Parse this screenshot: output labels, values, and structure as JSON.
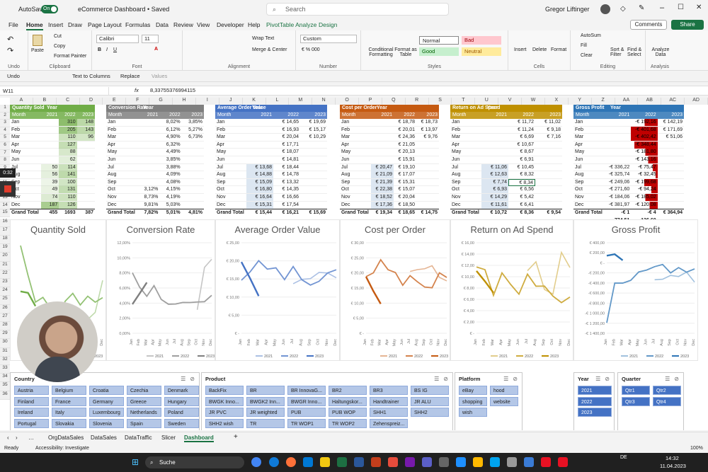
{
  "title_bar": {
    "autosave_label": "AutoSave",
    "autosave_state": "On",
    "file_name": "eCommerce Dashboard • Saved",
    "search_placeholder": "Search",
    "user_name": "Gregor Liftinger"
  },
  "menu": [
    "File",
    "Home",
    "Insert",
    "Draw",
    "Page Layout",
    "Formulas",
    "Data",
    "Review",
    "View",
    "Developer",
    "Help",
    "PivotTable Analyze",
    "Design"
  ],
  "menu_active": "Home",
  "buttons": {
    "comments": "Comments",
    "share": "Share"
  },
  "ribbon": {
    "undo": "Undo",
    "paste": "Paste",
    "cut": "Cut",
    "copy": "Copy",
    "format_painter": "Format Painter",
    "font_name": "Calibri",
    "font_size": "11",
    "wrap_text": "Wrap Text",
    "merge_center": "Merge & Center",
    "number_format": "Custom",
    "conditional_formatting": "Conditional Formatting",
    "format_as_table": "Format as Table",
    "style_normal": "Normal",
    "style_bad": "Bad",
    "style_good": "Good",
    "style_neutral": "Neutral",
    "insert": "Insert",
    "delete": "Delete",
    "format": "Format",
    "autosum": "AutoSum",
    "fill": "Fill",
    "clear": "Clear",
    "sort_filter": "Sort & Filter",
    "find_select": "Find & Select",
    "analyze_data": "Analyze Data",
    "groups": [
      "Undo",
      "Clipboard",
      "Font",
      "Alignment",
      "Number",
      "Styles",
      "Cells",
      "Editing",
      "Analysis"
    ]
  },
  "quick_access": {
    "undo": "Undo",
    "text_to_columns": "Text to Columns",
    "replace": "Replace",
    "values": "Values"
  },
  "formula_bar": {
    "name_box": "W11",
    "fx": "fx",
    "formula": "8,33755376994115"
  },
  "col_letters": [
    "A",
    "B",
    "C",
    "D",
    "E",
    "F",
    "G",
    "H",
    "I",
    "J",
    "K",
    "L",
    "M",
    "N",
    "O",
    "P",
    "Q",
    "R",
    "S",
    "T",
    "U",
    "V",
    "W",
    "X",
    "Y",
    "Z",
    "AA",
    "AB",
    "AC",
    "AD"
  ],
  "months": [
    "Jan",
    "Feb",
    "Mar",
    "Apr",
    "May",
    "Jun",
    "Jul",
    "Aug",
    "Sep",
    "Oct",
    "Nov",
    "Dec"
  ],
  "pivots": [
    {
      "title": "Quantity Sold",
      "color": "#70ad47",
      "year_label": "Year",
      "sub": [
        "Month",
        "2021",
        "2022",
        "2023"
      ],
      "rows": [
        [
          "",
          "310",
          "148"
        ],
        [
          "",
          "205",
          "143"
        ],
        [
          "",
          "110",
          "96"
        ],
        [
          "",
          "127",
          ""
        ],
        [
          "",
          "88",
          ""
        ],
        [
          "",
          "62",
          ""
        ],
        [
          "50",
          "114",
          ""
        ],
        [
          "56",
          "141",
          ""
        ],
        [
          "39",
          "100",
          ""
        ],
        [
          "49",
          "131",
          ""
        ],
        [
          "74",
          "110",
          ""
        ],
        [
          "187",
          "126",
          ""
        ]
      ],
      "total": [
        "455",
        "1693",
        "387"
      ]
    },
    {
      "title": "Conversion Rate",
      "color": "#7f7f7f",
      "year_label": "Year",
      "sub": [
        "Month",
        "2021",
        "2022",
        "2023"
      ],
      "rows": [
        [
          "",
          "8,02%",
          "3,85%"
        ],
        [
          "",
          "6,12%",
          "5,27%"
        ],
        [
          "",
          "4,90%",
          "6,73%"
        ],
        [
          "",
          "6,32%",
          ""
        ],
        [
          "",
          "4,49%",
          ""
        ],
        [
          "",
          "3,85%",
          ""
        ],
        [
          "",
          "3,88%",
          ""
        ],
        [
          "",
          "4,09%",
          ""
        ],
        [
          "",
          "4,08%",
          ""
        ],
        [
          "3,12%",
          "4,15%",
          ""
        ],
        [
          "8,73%",
          "4,19%",
          ""
        ],
        [
          "9,81%",
          "5,03%",
          ""
        ]
      ],
      "total": [
        "7,82%",
        "5,01%",
        "4,81%"
      ]
    },
    {
      "title": "Average Order Value",
      "color": "#4472c4",
      "year_label": "Year",
      "sub": [
        "Month",
        "2021",
        "2022",
        "2023"
      ],
      "rows": [
        [
          "",
          "€ 14,65",
          "€ 19,69"
        ],
        [
          "",
          "€ 16,93",
          "€ 15,17"
        ],
        [
          "",
          "€ 20,04",
          "€ 10,29"
        ],
        [
          "",
          "€ 17,71",
          ""
        ],
        [
          "",
          "€ 18,07",
          ""
        ],
        [
          "",
          "€ 14,81",
          ""
        ],
        [
          "€ 13,68",
          "€ 18,44",
          ""
        ],
        [
          "€ 14,88",
          "€ 14,78",
          ""
        ],
        [
          "€ 15,09",
          "€ 13,32",
          ""
        ],
        [
          "€ 16,80",
          "€ 14,35",
          ""
        ],
        [
          "€ 16,64",
          "€ 16,66",
          ""
        ],
        [
          "€ 15,31",
          "€ 17,54",
          ""
        ]
      ],
      "total": [
        "€ 15,44",
        "€ 16,21",
        "€ 15,69"
      ]
    },
    {
      "title": "Cost per Order",
      "color": "#c55a11",
      "year_label": "Year",
      "sub": [
        "Month",
        "2021",
        "2022",
        "2023"
      ],
      "rows": [
        [
          "",
          "€ 18,78",
          "€ 18,73"
        ],
        [
          "",
          "€ 20,01",
          "€ 13,97"
        ],
        [
          "",
          "€ 24,36",
          "€ 9,76"
        ],
        [
          "",
          "€ 21,05",
          ""
        ],
        [
          "",
          "€ 20,13",
          ""
        ],
        [
          "",
          "€ 15,91",
          ""
        ],
        [
          "€ 20,47",
          "€ 19,10",
          ""
        ],
        [
          "€ 21,09",
          "€ 17,07",
          ""
        ],
        [
          "€ 21,39",
          "€ 15,31",
          ""
        ],
        [
          "€ 22,38",
          "€ 15,07",
          ""
        ],
        [
          "€ 18,52",
          "€ 20,04",
          ""
        ],
        [
          "€ 17,36",
          "€ 18,50",
          ""
        ]
      ],
      "total": [
        "€ 19,34",
        "€ 18,65",
        "€ 14,75"
      ]
    },
    {
      "title": "Return on Ad Spend",
      "color": "#bf9000",
      "year_label": "Year",
      "sub": [
        "Month",
        "2021",
        "2022",
        "2023"
      ],
      "rows": [
        [
          "",
          "€ 11,72",
          "€ 11,02"
        ],
        [
          "",
          "€ 11,24",
          "€ 9,18"
        ],
        [
          "",
          "€ 6,69",
          "€ 7,16"
        ],
        [
          "",
          "€ 10,67",
          ""
        ],
        [
          "",
          "€ 8,67",
          ""
        ],
        [
          "",
          "€ 6,91",
          ""
        ],
        [
          "€ 11,06",
          "€ 10,45",
          ""
        ],
        [
          "€ 12,63",
          "€ 8,32",
          ""
        ],
        [
          "€ 7,74",
          "€ 8,34",
          ""
        ],
        [
          "€ 6,93",
          "€ 6,56",
          ""
        ],
        [
          "€ 14,29",
          "€ 5,42",
          ""
        ],
        [
          "€ 11,61",
          "€ 6,41",
          ""
        ]
      ],
      "total": [
        "€ 10,72",
        "€ 8,36",
        "€ 9,54"
      ]
    },
    {
      "title": "Gross Profit",
      "color": "#2e75b6",
      "year_label": "Year",
      "sub": [
        "Month",
        "2021",
        "2022",
        "2023"
      ],
      "rows": [
        [
          "",
          "-€ 192,16",
          "€ 142,19"
        ],
        [
          "",
          "-€ 401,68",
          "€ 171,69"
        ],
        [
          "",
          "-€ 402,42",
          "€ 51,06"
        ],
        [
          "",
          "-€ 348,44",
          ""
        ],
        [
          "",
          "-€ 181,80",
          ""
        ],
        [
          "",
          "-€ 143,16",
          ""
        ],
        [
          "-€ 336,22",
          "-€ 75,47",
          ""
        ],
        [
          "-€ 325,74",
          "-€ 32,45",
          ""
        ],
        [
          "-€ 249,06",
          "-€ 199,68",
          ""
        ],
        [
          "-€ 271,60",
          "-€ 94,24",
          ""
        ],
        [
          "-€ 184,06",
          "-€ 185,02",
          ""
        ],
        [
          "-€ 381,97",
          "-€ 120,08",
          ""
        ]
      ],
      "total": [
        "-€ 1 774,51",
        "-€ 4 136,60",
        "€ 364,94"
      ]
    }
  ],
  "grand_total_label": "Grand Total",
  "charts": [
    {
      "title": "Quantity Sold",
      "yticks": [],
      "color_2021": "#a9d18e",
      "color_2022": "#70ad47",
      "color_2023": "#375623"
    },
    {
      "title": "Conversion Rate",
      "yticks": [
        "12,00%",
        "10,00%",
        "8,00%",
        "6,00%",
        "4,00%",
        "2,00%",
        "0,00%"
      ]
    },
    {
      "title": "Average Order Value",
      "yticks": [
        "€ 25,00",
        "€ 20,00",
        "€ 15,00",
        "€ 10,00",
        "€ 5,00",
        "€ -"
      ]
    },
    {
      "title": "Cost per Order",
      "yticks": [
        "€ 30,00",
        "€ 25,00",
        "€ 20,00",
        "€ 15,00",
        "€ 10,00",
        "€ 5,00",
        "€ -"
      ]
    },
    {
      "title": "Return on Ad Spend",
      "yticks": [
        "€ 16,00",
        "€ 14,00",
        "€ 12,00",
        "€ 10,00",
        "€ 8,00",
        "€ 6,00",
        "€ 4,00",
        "€ 2,00",
        "€ -"
      ]
    },
    {
      "title": "Gross Profit",
      "yticks": [
        "€ 400,00",
        "€ 200,00",
        "€ -",
        "-€ 200,00",
        "-€ 400,00",
        "-€ 600,00",
        "-€ 800,00",
        "-€ 1 000,00",
        "-€ 1 200,00",
        "-€ 1 400,00"
      ]
    }
  ],
  "legend": [
    "2021",
    "2022",
    "2023"
  ],
  "chart_data": [
    {
      "type": "line",
      "title": "Quantity Sold",
      "x": [
        "Jan",
        "Feb",
        "Mar",
        "Apr",
        "May",
        "Jun",
        "Jul",
        "Aug",
        "Sep",
        "Oct",
        "Nov",
        "Dec"
      ],
      "series": [
        {
          "name": "2021",
          "values": [
            null,
            null,
            null,
            null,
            null,
            null,
            50,
            56,
            39,
            49,
            74,
            187
          ]
        },
        {
          "name": "2022",
          "values": [
            310,
            205,
            110,
            127,
            88,
            62,
            114,
            141,
            100,
            131,
            110,
            126
          ]
        },
        {
          "name": "2023",
          "values": [
            148,
            143,
            96,
            null,
            null,
            null,
            null,
            null,
            null,
            null,
            null,
            null
          ]
        }
      ]
    },
    {
      "type": "line",
      "title": "Conversion Rate",
      "x": [
        "Jan",
        "Feb",
        "Mar",
        "Apr",
        "May",
        "Jun",
        "Jul",
        "Aug",
        "Sep",
        "Oct",
        "Nov",
        "Dec"
      ],
      "ylim": [
        0,
        12
      ],
      "series": [
        {
          "name": "2021",
          "values": [
            null,
            null,
            null,
            null,
            null,
            null,
            null,
            null,
            null,
            3.12,
            8.73,
            9.81
          ]
        },
        {
          "name": "2022",
          "values": [
            8.02,
            6.12,
            4.9,
            6.32,
            4.49,
            3.85,
            3.88,
            4.09,
            4.08,
            4.15,
            4.19,
            5.03
          ]
        },
        {
          "name": "2023",
          "values": [
            3.85,
            5.27,
            6.73,
            null,
            null,
            null,
            null,
            null,
            null,
            null,
            null,
            null
          ]
        }
      ]
    },
    {
      "type": "line",
      "title": "Average Order Value",
      "x": [
        "Jan",
        "Feb",
        "Mar",
        "Apr",
        "May",
        "Jun",
        "Jul",
        "Aug",
        "Sep",
        "Oct",
        "Nov",
        "Dec"
      ],
      "ylim": [
        0,
        25
      ],
      "series": [
        {
          "name": "2021",
          "values": [
            null,
            null,
            null,
            null,
            null,
            null,
            13.68,
            14.88,
            15.09,
            16.8,
            16.64,
            15.31
          ]
        },
        {
          "name": "2022",
          "values": [
            14.65,
            16.93,
            20.04,
            17.71,
            18.07,
            14.81,
            18.44,
            14.78,
            13.32,
            14.35,
            16.66,
            17.54
          ]
        },
        {
          "name": "2023",
          "values": [
            19.69,
            15.17,
            10.29,
            null,
            null,
            null,
            null,
            null,
            null,
            null,
            null,
            null
          ]
        }
      ]
    },
    {
      "type": "line",
      "title": "Cost per Order",
      "x": [
        "Jan",
        "Feb",
        "Mar",
        "Apr",
        "May",
        "Jun",
        "Jul",
        "Aug",
        "Sep",
        "Oct",
        "Nov",
        "Dec"
      ],
      "ylim": [
        0,
        30
      ],
      "series": [
        {
          "name": "2021",
          "values": [
            null,
            null,
            null,
            null,
            null,
            null,
            20.47,
            21.09,
            21.39,
            22.38,
            18.52,
            17.36
          ]
        },
        {
          "name": "2022",
          "values": [
            18.78,
            20.01,
            24.36,
            21.05,
            20.13,
            15.91,
            19.1,
            17.07,
            15.31,
            15.07,
            20.04,
            18.5
          ]
        },
        {
          "name": "2023",
          "values": [
            18.73,
            13.97,
            9.76,
            null,
            null,
            null,
            null,
            null,
            null,
            null,
            null,
            null
          ]
        }
      ]
    },
    {
      "type": "line",
      "title": "Return on Ad Spend",
      "x": [
        "Jan",
        "Feb",
        "Mar",
        "Apr",
        "May",
        "Jun",
        "Jul",
        "Aug",
        "Sep",
        "Oct",
        "Nov",
        "Dec"
      ],
      "ylim": [
        0,
        16
      ],
      "series": [
        {
          "name": "2021",
          "values": [
            null,
            null,
            null,
            null,
            null,
            null,
            11.06,
            12.63,
            7.74,
            6.93,
            14.29,
            11.61
          ]
        },
        {
          "name": "2022",
          "values": [
            11.72,
            11.24,
            6.69,
            10.67,
            8.67,
            6.91,
            10.45,
            8.32,
            8.34,
            6.56,
            5.42,
            6.41
          ]
        },
        {
          "name": "2023",
          "values": [
            11.02,
            9.18,
            7.16,
            null,
            null,
            null,
            null,
            null,
            null,
            null,
            null,
            null
          ]
        }
      ]
    },
    {
      "type": "line",
      "title": "Gross Profit",
      "x": [
        "Jan",
        "Feb",
        "Mar",
        "Apr",
        "May",
        "Jun",
        "Jul",
        "Aug",
        "Sep",
        "Oct",
        "Nov",
        "Dec"
      ],
      "ylim": [
        -1400,
        400
      ],
      "series": [
        {
          "name": "2021",
          "values": [
            null,
            null,
            null,
            null,
            null,
            null,
            -336.22,
            -325.74,
            -249.06,
            -271.6,
            -184.06,
            -381.97
          ]
        },
        {
          "name": "2022",
          "values": [
            -1192.16,
            -401.68,
            -402.42,
            -348.44,
            -181.8,
            -143.16,
            -75.47,
            -32.45,
            -199.68,
            -94.24,
            -185.02,
            -120.08
          ]
        },
        {
          "name": "2023",
          "values": [
            142.19,
            171.69,
            51.06,
            null,
            null,
            null,
            null,
            null,
            null,
            null,
            null,
            null
          ]
        }
      ]
    }
  ],
  "slicers": {
    "country": {
      "title": "Country",
      "items": [
        "Austria",
        "Belgium",
        "Croatia",
        "Czechia",
        "Denmark",
        "Finland",
        "France",
        "Germany",
        "Greece",
        "Hungary",
        "Ireland",
        "Italy",
        "Luxembourg",
        "Netherlands",
        "Poland",
        "Portugal",
        "Slovakia",
        "Slovenia",
        "Spain",
        "Sweden"
      ]
    },
    "product": {
      "title": "Product",
      "items": [
        "BackFix",
        "BR",
        "BR InnovaG...",
        "BR2",
        "BR3",
        "BS IG",
        "BWGK Inno...",
        "BWGK2 Inn...",
        "BWGR Inno...",
        "Haltungskor...",
        "Handtrainer",
        "JR ALU",
        "JR PVC",
        "JR weighted",
        "PUB",
        "PUB WOP",
        "SHH1",
        "SHH2",
        "SHH2 wish",
        "TR",
        "TR WOP1",
        "TR WOP2",
        "Zehenspreiz..."
      ]
    },
    "platform": {
      "title": "Platform",
      "items": [
        "eBay",
        "hood",
        "shopping",
        "website",
        "wish"
      ]
    },
    "year": {
      "title": "Year",
      "items": [
        "2021",
        "2022",
        "2023"
      ]
    },
    "quarter": {
      "title": "Quarter",
      "items": [
        "Qtr1",
        "Qtr2",
        "Qtr3",
        "Qtr4"
      ]
    }
  },
  "sheet_tabs": [
    "OrgDataSales",
    "DataSales",
    "DataTraffic",
    "Slicer",
    "Dashboard"
  ],
  "active_tab": "Dashboard",
  "status": {
    "ready": "Ready",
    "accessibility": "Accessibility: Investigate",
    "zoom": "100%"
  },
  "taskbar": {
    "search": "Suche",
    "lang": "DE",
    "time": "14:32",
    "date": "11.04.2023"
  },
  "recording": {
    "timer": "0:32"
  }
}
